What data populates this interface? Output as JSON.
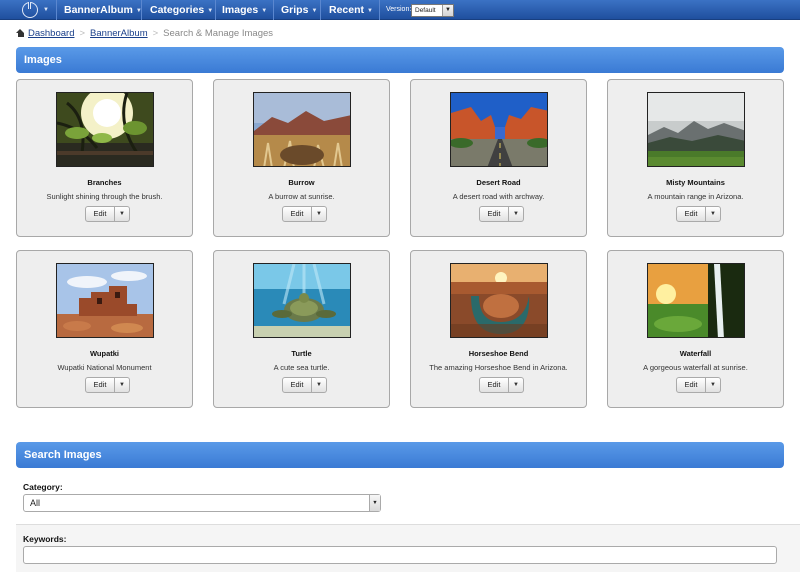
{
  "nav": {
    "items": [
      {
        "label": "BannerAlbum"
      },
      {
        "label": "Categories"
      },
      {
        "label": "Images"
      },
      {
        "label": "Grips"
      },
      {
        "label": "Recent"
      }
    ],
    "caret": "▼",
    "version_label": "Version:",
    "version_value": "Default"
  },
  "breadcrumb": {
    "dashboard": "Dashboard",
    "album": "BannerAlbum",
    "current": "Search & Manage Images",
    "separator": ">"
  },
  "images_section": {
    "title": "Images",
    "edit_label": "Edit",
    "caret": "▼",
    "cards": [
      {
        "title": "Branches",
        "description": "Sunlight shining through the brush.",
        "thumb_icon": "branches-photo"
      },
      {
        "title": "Burrow",
        "description": "A burrow at sunrise.",
        "thumb_icon": "burrow-photo"
      },
      {
        "title": "Desert Road",
        "description": "A desert road with archway.",
        "thumb_icon": "desert-road-photo"
      },
      {
        "title": "Misty Mountains",
        "description": "A mountain range in Arizona.",
        "thumb_icon": "misty-mountains-photo"
      },
      {
        "title": "Wupatki",
        "description": "Wupatki National Monument",
        "thumb_icon": "wupatki-photo"
      },
      {
        "title": "Turtle",
        "description": "A cute sea turtle.",
        "thumb_icon": "turtle-photo"
      },
      {
        "title": "Horseshoe Bend",
        "description": "The amazing Horseshoe Bend in Arizona.",
        "thumb_icon": "horseshoe-bend-photo"
      },
      {
        "title": "Waterfall",
        "description": "A gorgeous waterfall at sunrise.",
        "thumb_icon": "waterfall-photo"
      }
    ]
  },
  "search_section": {
    "title": "Search Images",
    "category_label": "Category:",
    "category_value": "All",
    "keywords_label": "Keywords:",
    "keywords_value": "",
    "caret": "▼"
  }
}
